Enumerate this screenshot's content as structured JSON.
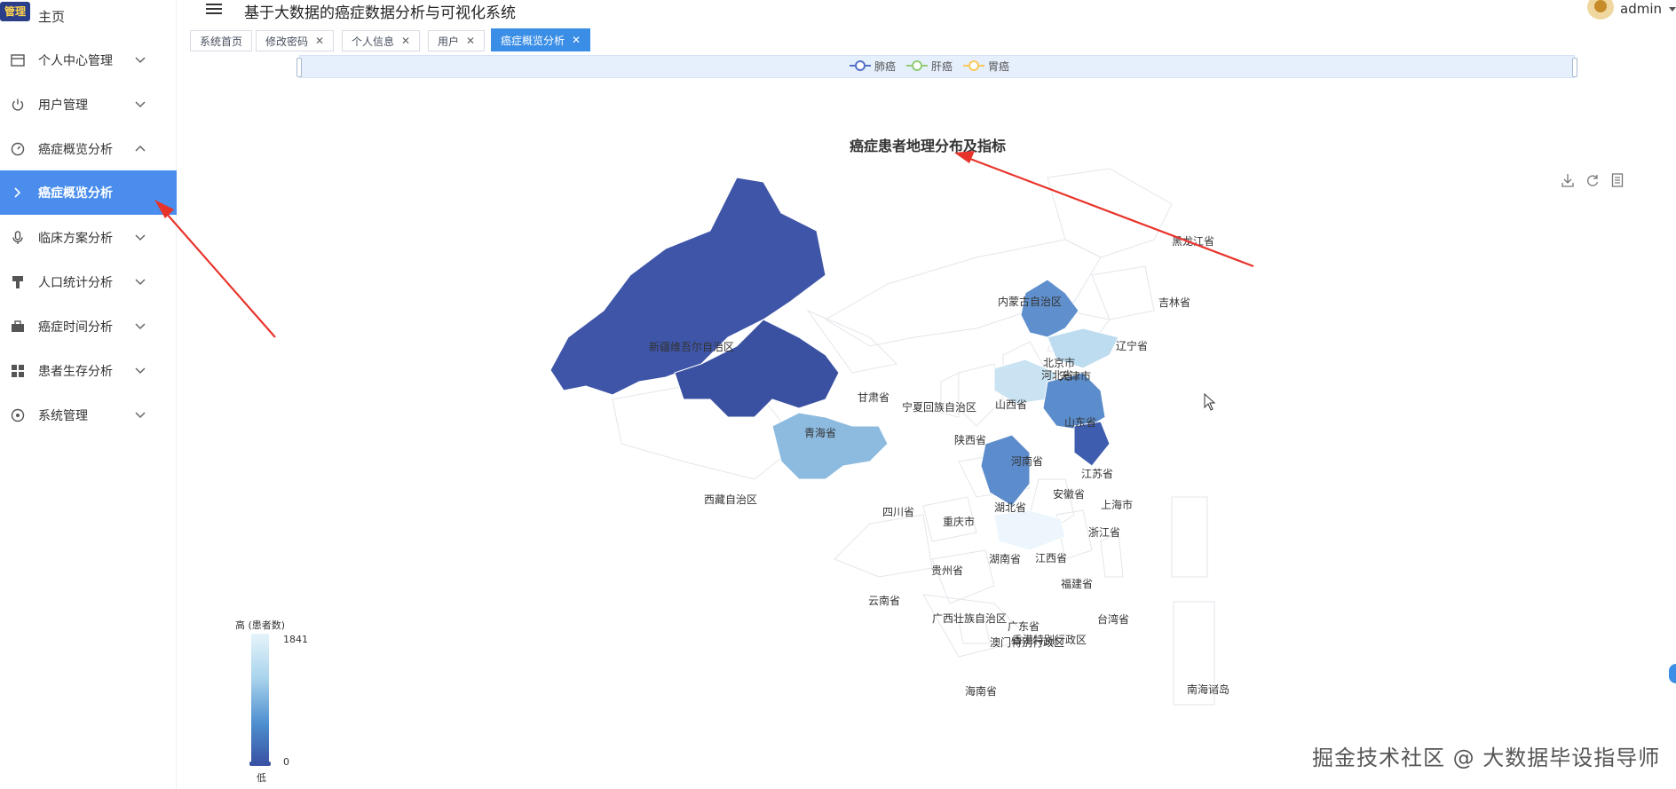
{
  "sidebar": {
    "logo_text": "管理",
    "home_label": "主页",
    "items": [
      {
        "label": "个人中心管理",
        "icon": "card-icon",
        "expanded": false
      },
      {
        "label": "用户管理",
        "icon": "power-icon",
        "expanded": false
      },
      {
        "label": "癌症概览分析",
        "icon": "gauge-icon",
        "expanded": true
      },
      {
        "label": "癌症概览分析",
        "icon": "chevron-right-icon",
        "active": true,
        "sub": true
      },
      {
        "label": "临床方案分析",
        "icon": "microphone-icon",
        "expanded": false
      },
      {
        "label": "人口统计分析",
        "icon": "brush-icon",
        "expanded": false
      },
      {
        "label": "癌症时间分析",
        "icon": "briefcase-icon",
        "expanded": false
      },
      {
        "label": "患者生存分析",
        "icon": "grid-icon",
        "expanded": false
      },
      {
        "label": "系统管理",
        "icon": "settings-circle-icon",
        "expanded": false
      }
    ]
  },
  "header": {
    "title": "基于大数据的癌症数据分析与可视化系统",
    "user": "admin"
  },
  "tabs": [
    {
      "label": "系统首页",
      "closable": false
    },
    {
      "label": "修改密码",
      "closable": true
    },
    {
      "label": "个人信息",
      "closable": true
    },
    {
      "label": "用户",
      "closable": true
    },
    {
      "label": "癌症概览分析",
      "closable": true,
      "active": true
    }
  ],
  "legend": [
    {
      "label": "肺癌",
      "color": "#5470c6"
    },
    {
      "label": "肝癌",
      "color": "#91cc75"
    },
    {
      "label": "胃癌",
      "color": "#fac858"
    }
  ],
  "chart_data": {
    "type": "map",
    "title": "癌症患者地理分布及指标",
    "visual_map": {
      "top_label": "高 (患者数)",
      "bottom_label": "低",
      "max": 1841,
      "min": 0
    },
    "regions": [
      {
        "name": "新疆维吾尔自治区",
        "level": "high"
      },
      {
        "name": "青海省",
        "level": "high"
      },
      {
        "name": "四川省",
        "level": "medium-low"
      },
      {
        "name": "北京市",
        "level": "medium"
      },
      {
        "name": "河北省",
        "level": "medium"
      },
      {
        "name": "天津市",
        "level": "medium"
      },
      {
        "name": "山东省",
        "level": "low"
      },
      {
        "name": "河南省",
        "level": "low"
      },
      {
        "name": "江苏省",
        "level": "medium"
      },
      {
        "name": "安徽省",
        "level": "medium"
      },
      {
        "name": "上海市",
        "level": "medium"
      },
      {
        "name": "浙江省",
        "level": "medium-high"
      },
      {
        "name": "湖南省",
        "level": "medium"
      },
      {
        "name": "广东省",
        "level": "very-low"
      },
      {
        "name": "香港特别行政区",
        "level": "very-low"
      },
      {
        "name": "澳门特别行政区",
        "level": "very-low"
      }
    ],
    "labels": [
      "黑龙江省",
      "吉林省",
      "辽宁省",
      "内蒙古自治区",
      "北京市",
      "河北省",
      "天津市",
      "山西省",
      "宁夏回族自治区",
      "甘肃省",
      "新疆维吾尔自治区",
      "青海省",
      "陕西省",
      "山东省",
      "河南省",
      "江苏省",
      "安徽省",
      "上海市",
      "西藏自治区",
      "四川省",
      "湖北省",
      "重庆市",
      "浙江省",
      "湖南省",
      "江西省",
      "贵州省",
      "福建省",
      "云南省",
      "广西壮族自治区",
      "广东省",
      "台湾省",
      "澳门特别行政区",
      "香港特别行政区",
      "海南省",
      "南海诸岛"
    ]
  },
  "toolbox": [
    "download-icon",
    "refresh-icon",
    "document-icon"
  ],
  "watermark": "掘金技术社区 @ 大数据毕设指导师"
}
